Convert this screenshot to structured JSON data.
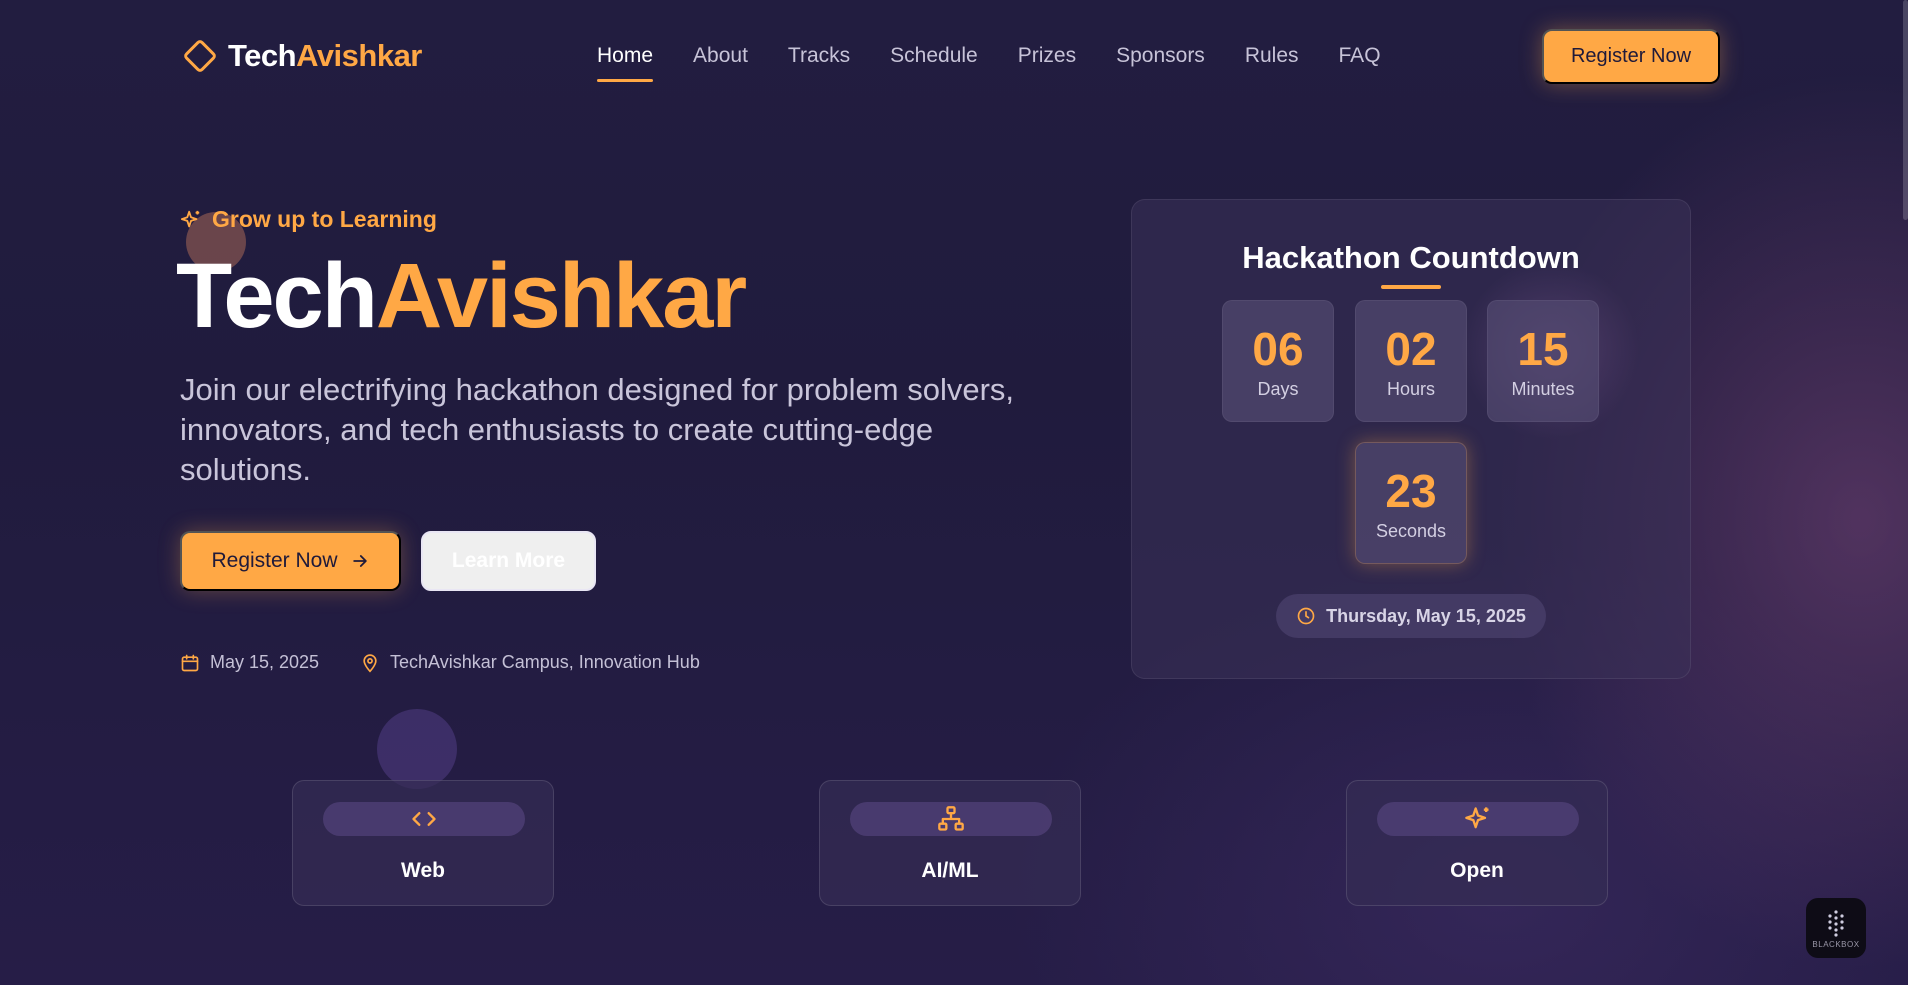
{
  "nav": {
    "logo": {
      "part1": "Tech",
      "part2": "Avishkar"
    },
    "items": [
      {
        "label": "Home",
        "active": true
      },
      {
        "label": "About"
      },
      {
        "label": "Tracks"
      },
      {
        "label": "Schedule"
      },
      {
        "label": "Prizes"
      },
      {
        "label": "Sponsors"
      },
      {
        "label": "Rules"
      },
      {
        "label": "FAQ"
      }
    ],
    "cta_label": "Register Now"
  },
  "hero": {
    "tagline": "Grow up to Learning",
    "title_part1": "Tech",
    "title_part2": "Avishkar",
    "description": "Join our electrifying hackathon designed for problem solvers, innovators, and tech enthusiasts to create cutting-edge solutions.",
    "primary_button": "Register Now",
    "secondary_button": "Learn More",
    "date": "May 15, 2025",
    "location": "TechAvishkar Campus, Innovation Hub"
  },
  "countdown": {
    "title": "Hackathon Countdown",
    "units": [
      {
        "value": "06",
        "label": "Days"
      },
      {
        "value": "02",
        "label": "Hours"
      },
      {
        "value": "15",
        "label": "Minutes"
      },
      {
        "value": "23",
        "label": "Seconds"
      }
    ],
    "event_date": "Thursday, May 15, 2025"
  },
  "tracks": [
    {
      "label": "Web",
      "icon": "code-icon"
    },
    {
      "label": "AI/ML",
      "icon": "network-icon"
    },
    {
      "label": "Open",
      "icon": "sparkle-icon"
    }
  ],
  "badge": {
    "text": "BLACKBOX"
  },
  "colors": {
    "accent": "#ffa845",
    "background": "#211c3f",
    "card": "#3a3258"
  }
}
